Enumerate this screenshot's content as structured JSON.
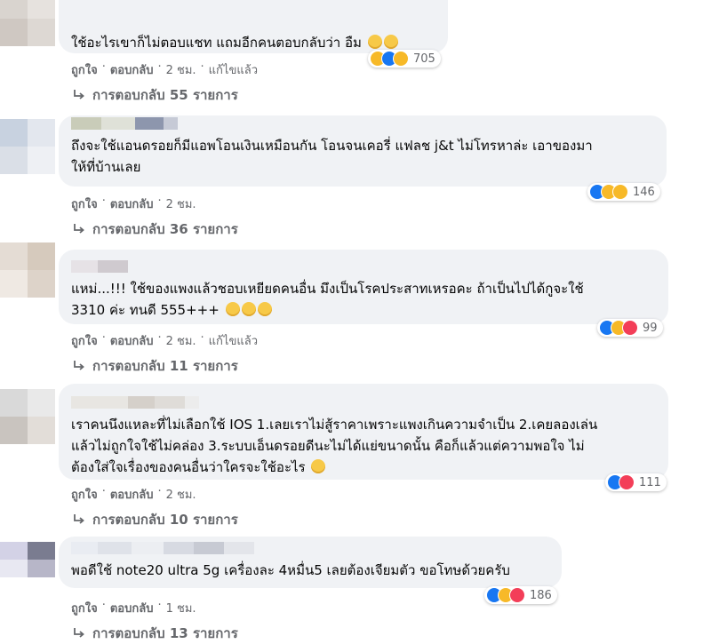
{
  "comments": [
    {
      "text": "ใช้อะไรเขาก็ไม่ตอบแชท แถมอีกคนตอบกลับว่า อืม",
      "reaction_count": "705",
      "actions": [
        "ถูกใจ",
        "ตอบกลับ",
        "2 ชม.",
        "แก้ไขแล้ว"
      ],
      "replies": "การตอบกลับ 55 รายการ"
    },
    {
      "text_lines": [
        "ถึงจะใช้แอนดรอยก็มีแอพโอนเงินเหมือนกัน โอนจนเคอรี่ แฟลช j&t ไม่โทรหาล่ะ เอาของมา",
        "ให้ที่บ้านเลย"
      ],
      "reaction_count": "146",
      "actions": [
        "ถูกใจ",
        "ตอบกลับ",
        "2 ชม."
      ],
      "replies": "การตอบกลับ 36 รายการ"
    },
    {
      "text_lines": [
        "แหม่...!!! ใช้ของแพงแล้วชอบเหยียดคนอื่น มึงเป็นโรคประสาทเหรอคะ ถ้าเป็นไปได้กูจะใช้",
        "3310 ค่ะ ทนดี 555+++"
      ],
      "reaction_count": "99",
      "actions": [
        "ถูกใจ",
        "ตอบกลับ",
        "2 ชม.",
        "แก้ไขแล้ว"
      ],
      "replies": "การตอบกลับ 11 รายการ"
    },
    {
      "text_lines": [
        "เราคนนึงแหละที่ไม่เลือกใช้ IOS 1.เลยเราไม่สู้ราคาเพราะแพงเกินความจำเป็น 2.เคยลองเล่น",
        "แล้วไม่ถูกใจใช้ไม่คล่อง 3.ระบบเอ็นดรอยดีนะไม่ได้แย่ขนาดนั้น คือก็แล้วแต่ความพอใจ ไม่",
        "ต้องใส่ใจเรื่องของคนอื่นว่าใครจะใช้อะไร"
      ],
      "reaction_count": "111",
      "actions": [
        "ถูกใจ",
        "ตอบกลับ",
        "2 ชม."
      ],
      "replies": "การตอบกลับ 10 รายการ"
    },
    {
      "text": "พอดีใช้ note20 ultra 5g เครื่องละ 4หมื่น5 เลยต้องเจียมตัว ขอโทษด้วยครับ",
      "reaction_count": "186",
      "actions": [
        "ถูกใจ",
        "ตอบกลับ",
        "1 ชม."
      ],
      "replies": "การตอบกลับ 13 รายการ"
    }
  ],
  "colors": {
    "bubble": "#f0f2f5",
    "meta_text": "#65676b",
    "like": "#1877f2",
    "love": "#f33e58",
    "haha": "#f7b928"
  }
}
